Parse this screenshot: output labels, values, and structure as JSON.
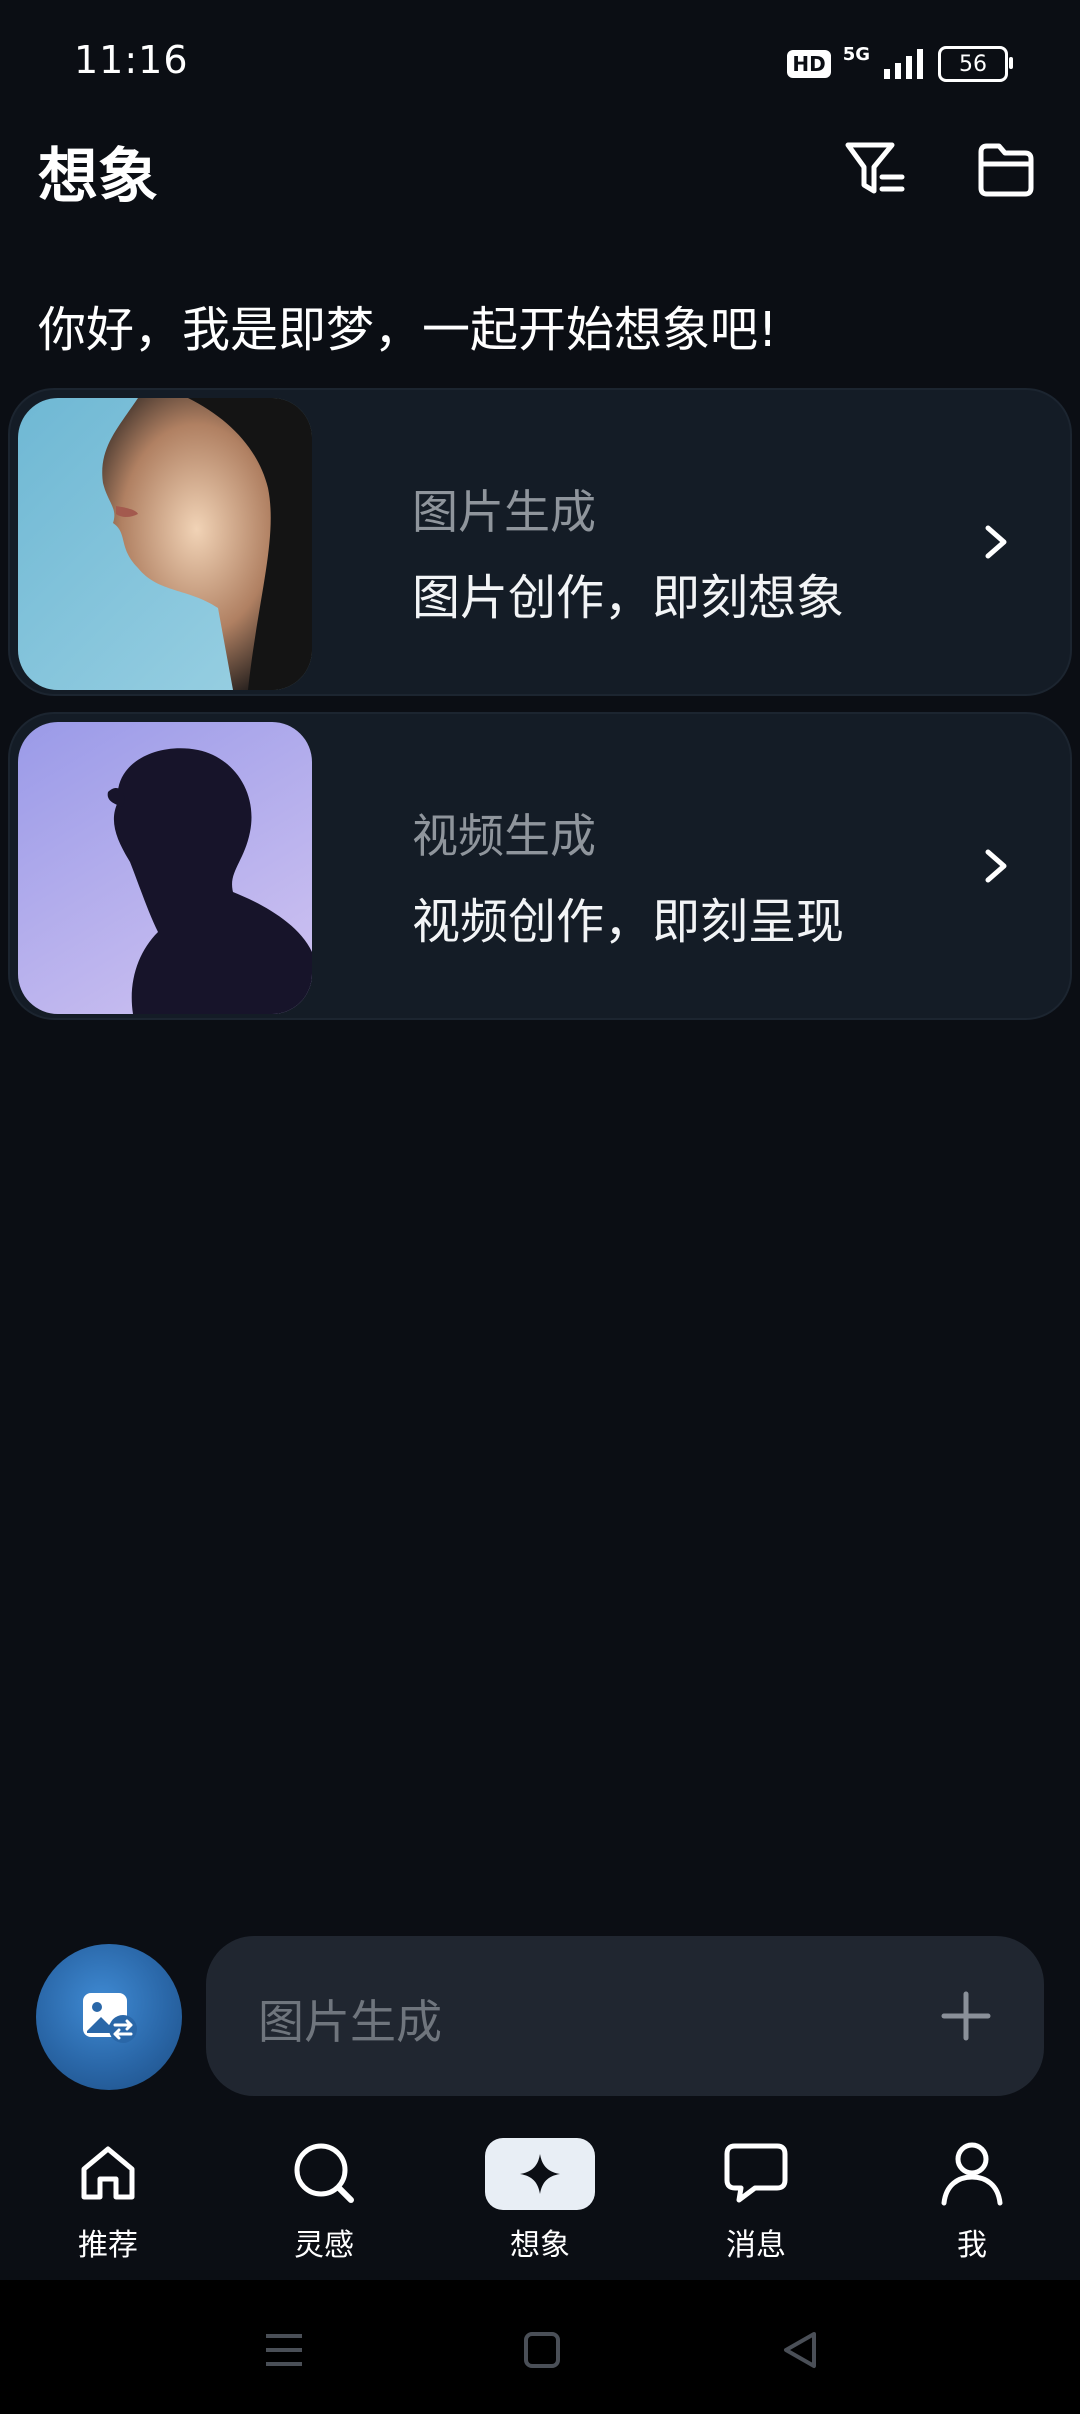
{
  "status": {
    "time": "11:16",
    "hd": "HD",
    "network": "5G",
    "battery": "56"
  },
  "header": {
    "title": "想象"
  },
  "greeting": "你好，我是即梦，一起开始想象吧!",
  "cards": [
    {
      "label": "图片生成",
      "description": "图片创作，即刻想象"
    },
    {
      "label": "视频生成",
      "description": "视频创作，即刻呈现"
    }
  ],
  "prompt": {
    "placeholder": "图片生成"
  },
  "nav": [
    {
      "label": "推荐",
      "icon": "home-icon"
    },
    {
      "label": "灵感",
      "icon": "search-icon"
    },
    {
      "label": "想象",
      "icon": "sparkle-icon",
      "active": true
    },
    {
      "label": "消息",
      "icon": "message-icon"
    },
    {
      "label": "我",
      "icon": "profile-icon"
    }
  ],
  "colors": {
    "background": "#0b0e14",
    "card": "#141c26",
    "accent": "#2a67a8",
    "input": "#202630"
  }
}
